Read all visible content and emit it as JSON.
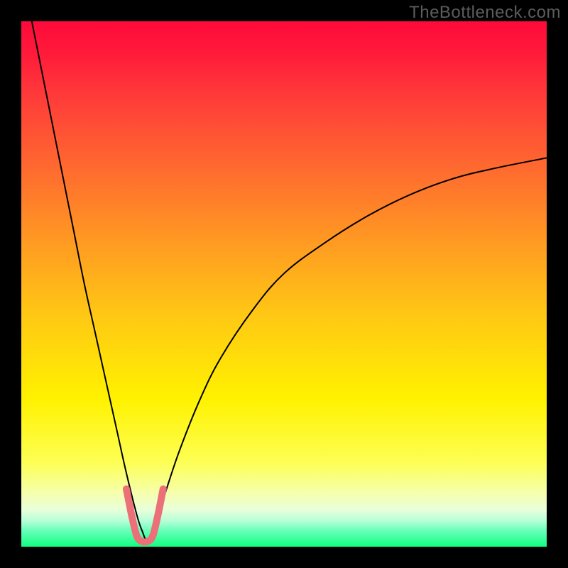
{
  "watermark": "TheBottleneck.com",
  "chart_data": {
    "type": "line",
    "title": "",
    "xlabel": "",
    "ylabel": "",
    "xlim": [
      0,
      100
    ],
    "ylim": [
      0,
      100
    ],
    "gradient_stops": [
      {
        "pos": 0,
        "color": "#ff0a3a"
      },
      {
        "pos": 6,
        "color": "#ff1a3a"
      },
      {
        "pos": 14,
        "color": "#ff3a3a"
      },
      {
        "pos": 28,
        "color": "#ff6a2f"
      },
      {
        "pos": 42,
        "color": "#ff9a22"
      },
      {
        "pos": 56,
        "color": "#ffc814"
      },
      {
        "pos": 72,
        "color": "#fff200"
      },
      {
        "pos": 84,
        "color": "#fdff55"
      },
      {
        "pos": 90,
        "color": "#f5ffb0"
      },
      {
        "pos": 93,
        "color": "#e8ffda"
      },
      {
        "pos": 95,
        "color": "#b8ffd8"
      },
      {
        "pos": 97,
        "color": "#67ffb8"
      },
      {
        "pos": 100,
        "color": "#10ff80"
      }
    ],
    "series": [
      {
        "name": "black-curve",
        "color": "#000000",
        "stroke_width": 2,
        "x": [
          2,
          4,
          6,
          8,
          10,
          12,
          14,
          16,
          18,
          20,
          22,
          23,
          24,
          25,
          27,
          30,
          34,
          38,
          44,
          50,
          58,
          66,
          74,
          82,
          90,
          100
        ],
        "y": [
          100,
          90,
          80,
          70,
          60,
          50,
          41,
          32,
          23,
          14,
          6,
          3,
          1,
          3,
          9,
          18,
          28,
          36,
          45,
          52,
          58,
          63,
          67,
          70,
          72,
          74
        ]
      },
      {
        "name": "pink-dip",
        "color": "#ec7078",
        "stroke_width": 10,
        "x": [
          20,
          21,
          22,
          23,
          24,
          25,
          26,
          27
        ],
        "y": [
          11,
          6,
          2,
          1,
          1,
          2,
          6,
          11
        ]
      }
    ]
  }
}
